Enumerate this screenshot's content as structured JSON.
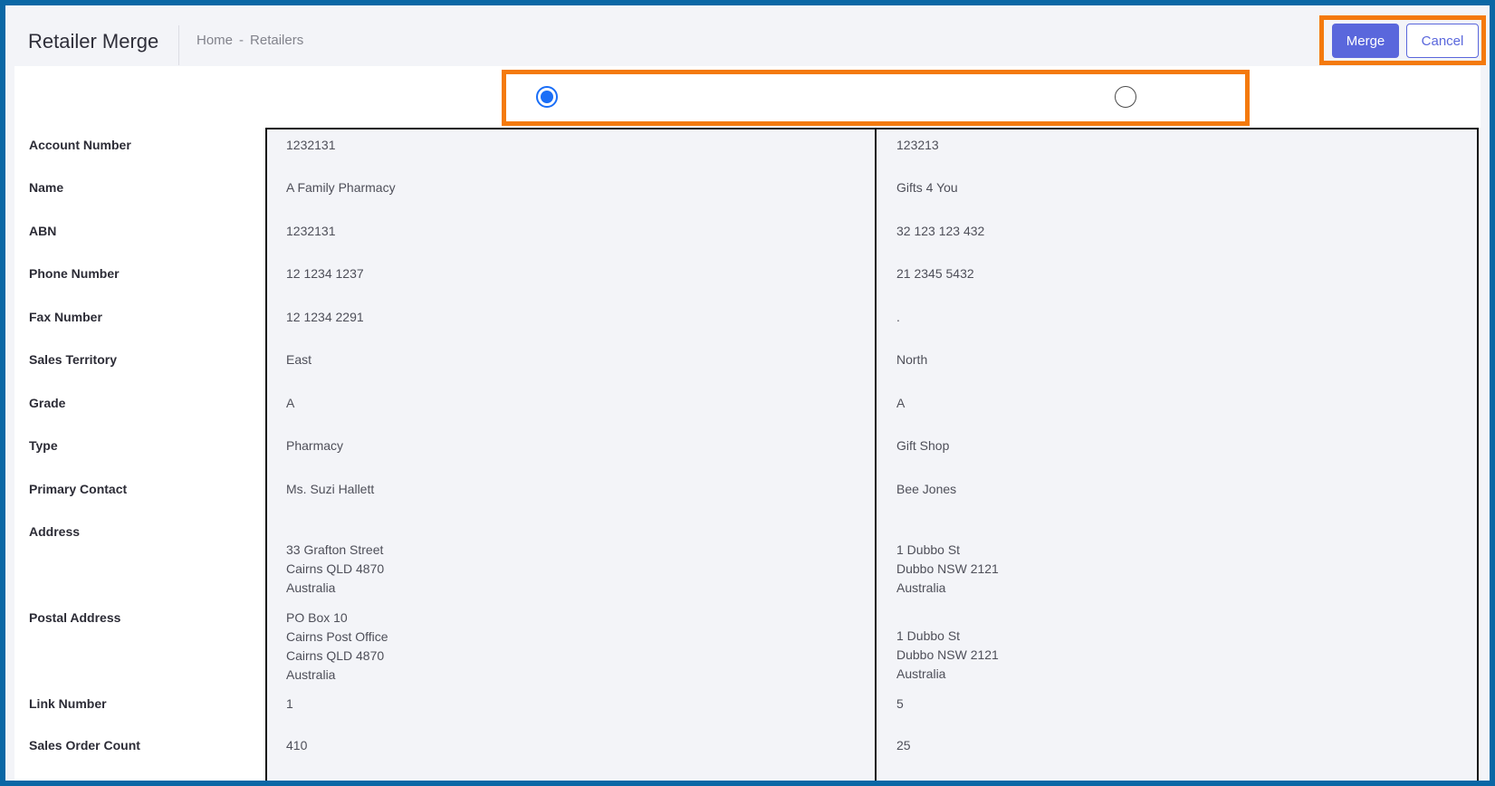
{
  "header": {
    "title": "Retailer Merge",
    "breadcrumb": [
      "Home",
      "Retailers"
    ],
    "breadcrumb_separator": "-"
  },
  "buttons": {
    "merge_label": "Merge",
    "cancel_label": "Cancel"
  },
  "colors": {
    "accent": "#5a67dc",
    "highlight": "#f47a0d",
    "radio_selected": "#1a6ef7",
    "frame": "#0a67a5"
  },
  "selection": {
    "selected_record": "left"
  },
  "fields": {
    "account_number": "Account Number",
    "name": "Name",
    "abn": "ABN",
    "phone_number": "Phone Number",
    "fax_number": "Fax Number",
    "sales_territory": "Sales Territory",
    "grade": "Grade",
    "type": "Type",
    "primary_contact": "Primary Contact",
    "address": "Address",
    "postal_address": "Postal Address",
    "link_number": "Link Number",
    "sales_order_count": "Sales Order Count"
  },
  "records": [
    {
      "account_number": "1232131",
      "name": "A Family Pharmacy",
      "abn": "1232131",
      "phone_number": "12 1234 1237",
      "fax_number": "12 1234 2291",
      "sales_territory": "East",
      "grade": "A",
      "type": "Pharmacy",
      "primary_contact": "Ms. Suzi Hallett",
      "address": [
        "33 Grafton Street",
        "Cairns QLD 4870",
        "Australia"
      ],
      "postal_address": [
        "PO Box 10",
        "Cairns Post Office",
        "Cairns QLD 4870",
        "Australia"
      ],
      "link_number": "1",
      "sales_order_count": "410"
    },
    {
      "account_number": "123213",
      "name": "Gifts 4 You",
      "abn": "32 123 123 432",
      "phone_number": "21 2345 5432",
      "fax_number": ".",
      "sales_territory": "North",
      "grade": "A",
      "type": "Gift Shop",
      "primary_contact": "Bee Jones",
      "address": [
        "1 Dubbo St",
        "Dubbo NSW 2121",
        "Australia"
      ],
      "postal_address": [
        "1 Dubbo St",
        "Dubbo NSW 2121",
        "Australia"
      ],
      "link_number": "5",
      "sales_order_count": "25"
    }
  ]
}
